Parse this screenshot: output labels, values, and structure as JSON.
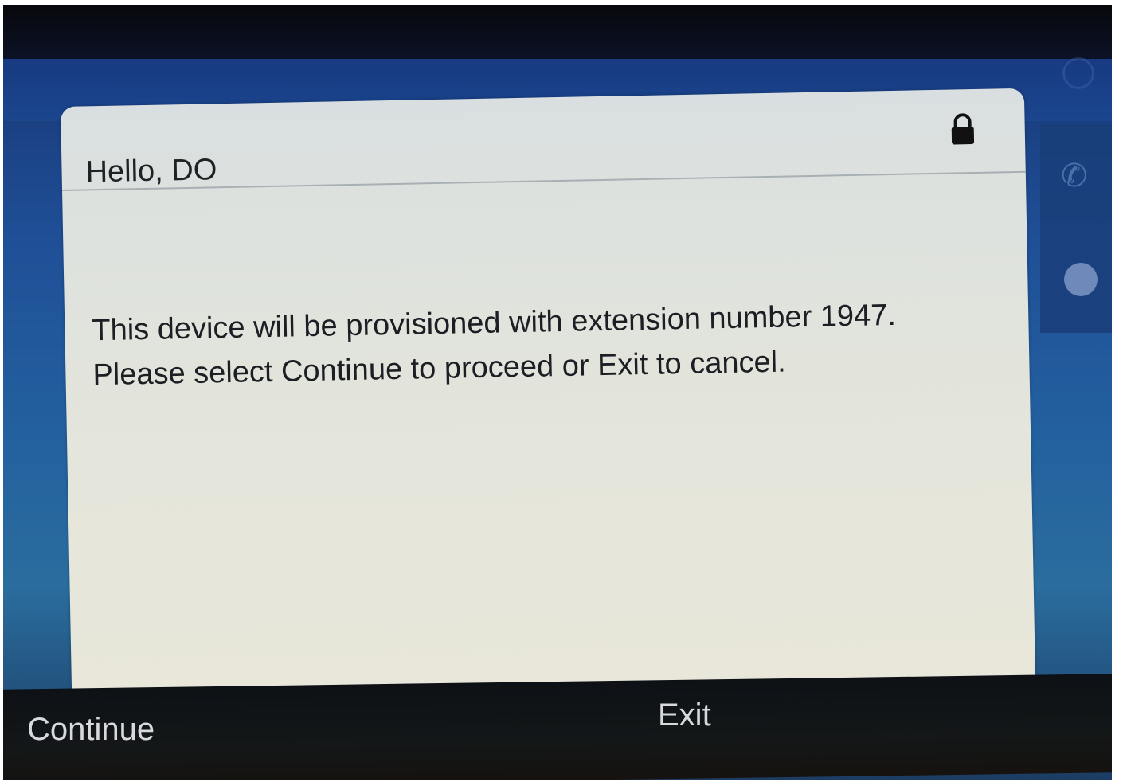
{
  "dialog": {
    "title": "Hello, DO",
    "message_line1": "This device will be provisioned with extension number 1947.",
    "message_line2": "Please select Continue to proceed or Exit to cancel."
  },
  "softkeys": {
    "continue_label": "Continue",
    "exit_label": "Exit"
  },
  "icons": {
    "lock": "lock-icon",
    "phone": "phone-icon",
    "recents": "clock-icon"
  },
  "colors": {
    "screen_background": "#1f4f97",
    "dialog_background": "#e1e4dc",
    "softkey_bar": "#141718",
    "softkey_text": "#d7d9dc"
  }
}
